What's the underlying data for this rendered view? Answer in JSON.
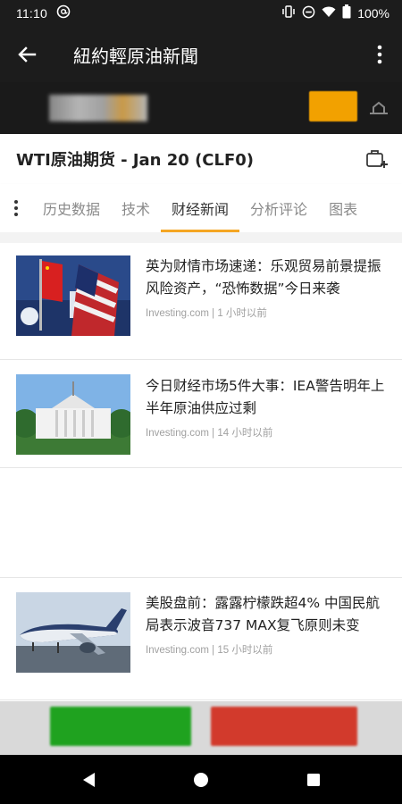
{
  "status_bar": {
    "time": "11:10",
    "battery": "100%"
  },
  "app_bar": {
    "title": "紐約輕原油新聞"
  },
  "ad_banner": {
    "cta_color": "#f2a100"
  },
  "instrument": {
    "title": "WTI原油期货 - Jan 20 (CLF0)"
  },
  "tabs": {
    "items": [
      {
        "label": "历史数据",
        "active": false
      },
      {
        "label": "技术",
        "active": false
      },
      {
        "label": "财经新闻",
        "active": true
      },
      {
        "label": "分析评论",
        "active": false
      },
      {
        "label": "图表",
        "active": false
      }
    ],
    "accent": "#f5a623"
  },
  "news": [
    {
      "headline": "英为财情市场速递：乐观贸易前景提振风险资产，“恐怖数据”今日来袭",
      "source": "Investing.com",
      "time": "1 小时以前",
      "thumb_icon": "flags-press-photo"
    },
    {
      "headline": "今日财经市场5件大事：IEA警告明年上半年原油供应过剩",
      "source": "Investing.com",
      "time": "14 小时以前",
      "thumb_icon": "white-house-photo"
    },
    {
      "headline": "美股盘前：露露柠檬跌超4% 中国民航局表示波音737 MAX复飞原则未变",
      "source": "Investing.com",
      "time": "15 小时以前",
      "thumb_icon": "boeing-plane-photo"
    }
  ],
  "bottom_actions": {
    "buy_color": "#1fa21f",
    "sell_color": "#d23a2c"
  }
}
